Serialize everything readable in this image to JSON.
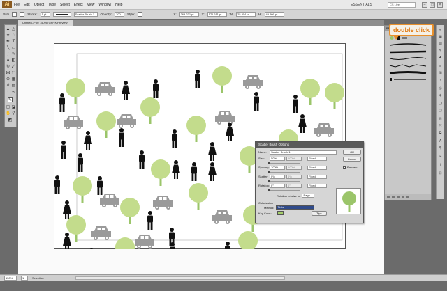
{
  "app": {
    "logo": "Ai",
    "menus": [
      "File",
      "Edit",
      "Object",
      "Type",
      "Select",
      "Effect",
      "View",
      "Window",
      "Help"
    ],
    "workspace": "ESSENTIALS",
    "search_placeholder": "CS Live"
  },
  "controlbar": {
    "selection": "Path",
    "stroke_label": "Stroke:",
    "stroke_weight": "1 pt",
    "brush_name": "Scatter Brush 1",
    "opacity_label": "Opacity:",
    "opacity": "100",
    "style_label": "Style:",
    "x_label": "X:",
    "x_value": "369.231 pt",
    "y_label": "Y:",
    "y_value": "176.611 pt",
    "w_label": "W:",
    "w_value": "25.404 pt",
    "h_label": "H:",
    "h_value": "49.999 pt"
  },
  "document_tab": "Untitled-1* @ 150% (CMYK/Preview)",
  "status": {
    "zoom": "150%",
    "artboard": "1",
    "tool": "Selection"
  },
  "callout": "double click",
  "brushes_panel": {
    "tab": "BRUSHES"
  },
  "dialog": {
    "title": "Scatter Brush Options",
    "name_label": "Name:",
    "name_value": "Scatter Brush 1",
    "size_label": "Size:",
    "size_value": "50%",
    "size_max": "100%",
    "size_mode": "Fixed",
    "spacing_label": "Spacing:",
    "spacing_value": "100%",
    "spacing_max": "100%",
    "spacing_mode": "Fixed",
    "scatter_label": "Scatter:",
    "scatter_value": "0%",
    "scatter_max": "0%",
    "scatter_mode": "Fixed",
    "rotation_label": "Rotation:",
    "rotation_value": "0°",
    "rotation_max": "0°",
    "rotation_mode": "Fixed",
    "rotation_relative_label": "Rotation relative to:",
    "rotation_relative_value": "Page",
    "colorization_label": "Colorization",
    "method_label": "Method:",
    "method_value": "Tints",
    "key_color_label": "Key Color:",
    "tips_label": "Tips",
    "ok_label": "OK",
    "cancel_label": "Cancel",
    "preview_label": "Preview",
    "preview_checked": true
  },
  "colors": {
    "tree_green": "#c3dc8c",
    "tree_trunk": "#9bc56a",
    "car_gray": "#9a9a9a",
    "person_black": "#111111",
    "callout_orange": "#e8902c"
  }
}
